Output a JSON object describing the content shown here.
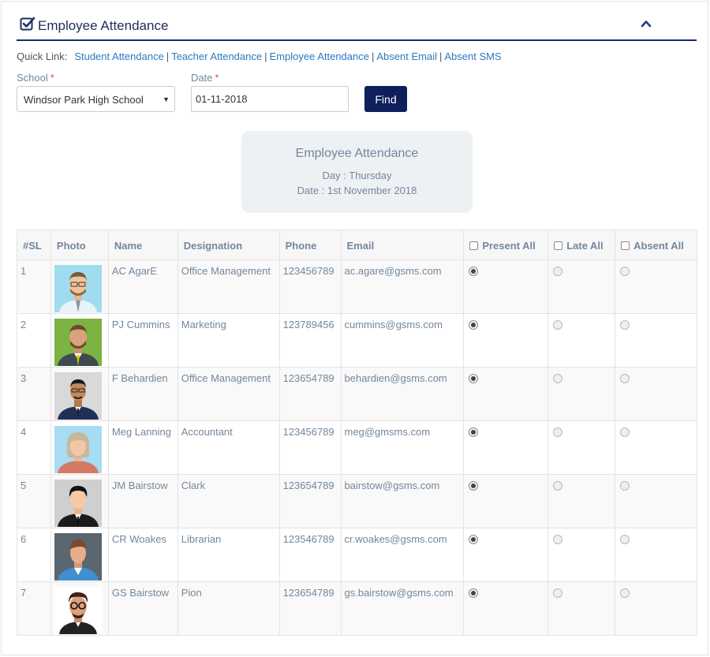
{
  "panel": {
    "title": "Employee Attendance",
    "icon": "check-square-icon",
    "collapse_icon": "chevron-up-icon"
  },
  "quick_links": {
    "label": "Quick Link:",
    "links": [
      "Student Attendance",
      "Teacher Attendance",
      "Employee Attendance",
      "Absent Email",
      "Absent SMS"
    ]
  },
  "form": {
    "school_label": "School",
    "school_value": "Windsor Park High School",
    "date_label": "Date",
    "required_mark": "*",
    "date_value": "01-11-2018",
    "find_label": "Find"
  },
  "summary": {
    "title": "Employee Attendance",
    "day": "Day : Thursday",
    "date": "Date : 1st November 2018"
  },
  "table": {
    "headers": {
      "sl": "#SL",
      "photo": "Photo",
      "name": "Name",
      "designation": "Designation",
      "phone": "Phone",
      "email": "Email",
      "present_all": "Present All",
      "late_all": "Late All",
      "absent_all": "Absent All"
    },
    "rows": [
      {
        "sl": "1",
        "name": "AC AgarE",
        "designation": "Office Management",
        "phone": "123456789",
        "email": "ac.agare@gsms.com",
        "status": "present"
      },
      {
        "sl": "2",
        "name": "PJ Cummins",
        "designation": "Marketing",
        "phone": "123789456",
        "email": "cummins@gsms.com",
        "status": "present"
      },
      {
        "sl": "3",
        "name": "F Behardien",
        "designation": "Office Management",
        "phone": "123654789",
        "email": "behardien@gsms.com",
        "status": "present"
      },
      {
        "sl": "4",
        "name": "Meg Lanning",
        "designation": "Accountant",
        "phone": "123456789",
        "email": "meg@gmsms.com",
        "status": "present"
      },
      {
        "sl": "5",
        "name": "JM Bairstow",
        "designation": "Clark",
        "phone": "123654789",
        "email": "bairstow@gsms.com",
        "status": "present"
      },
      {
        "sl": "6",
        "name": "CR Woakes",
        "designation": "Librarian",
        "phone": "123546789",
        "email": "cr.woakes@gsms.com",
        "status": "present"
      },
      {
        "sl": "7",
        "name": "GS Bairstow",
        "designation": "Pion",
        "phone": "123654789",
        "email": "gs.bairstow@gsms.com",
        "status": "present"
      }
    ]
  },
  "colors": {
    "accent": "#0e1f5b",
    "link": "#2a7bc1",
    "text": "#73879c",
    "required": "#d9534f"
  }
}
